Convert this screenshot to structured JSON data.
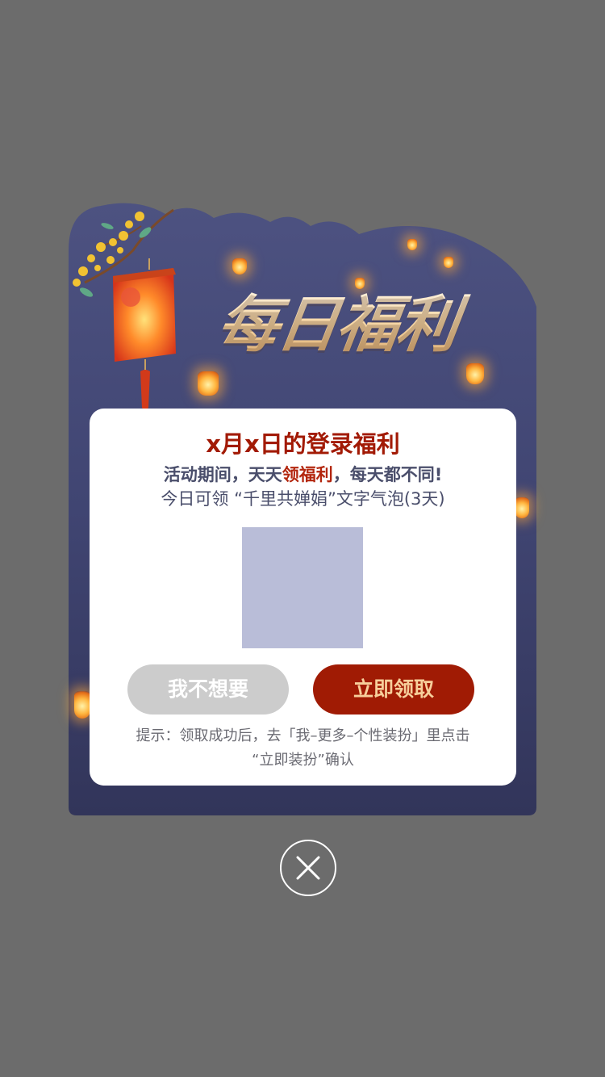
{
  "popup": {
    "banner_title": "每日福利",
    "card_title": "x月x日的登录福利",
    "subtitle_before": "活动期间，天天",
    "subtitle_highlight": "领福利",
    "subtitle_after": "，每天都不同!",
    "reward_line": "今日可领 “千里共婵娟”文字气泡(3天)",
    "decline_label": "我不想要",
    "claim_label": "立即领取",
    "tip_line1": "提示：领取成功后，去「我–更多–个性装扮」里点击",
    "tip_line2": "“立即装扮”确认"
  },
  "colors": {
    "overlay": "#6c6c6c",
    "panel": "#3f4368",
    "title_red": "#a21a05",
    "claim_button": "#a01b04",
    "claim_text": "#f7cf9b",
    "decline_button": "#cccccc",
    "reward_placeholder": "#b9bdd8"
  },
  "icons": {
    "close": "close-icon",
    "lantern": "lantern-icon",
    "flowers": "osmanthus-flower-icon"
  }
}
